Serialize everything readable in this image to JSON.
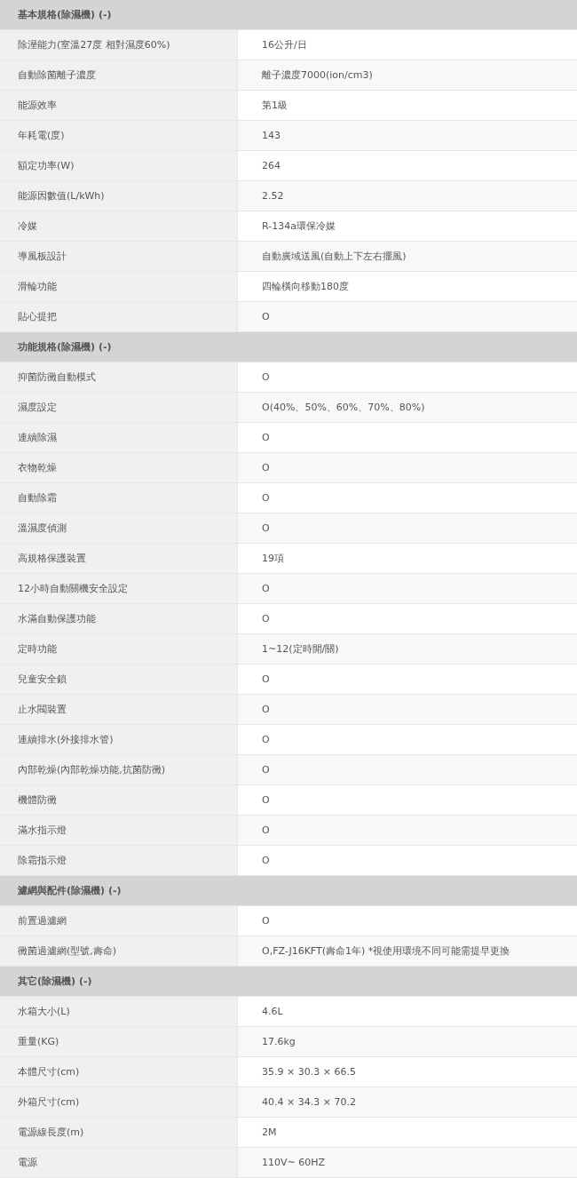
{
  "sections": [
    {
      "title": "基本規格(除濕機) (-)",
      "rows": [
        {
          "label": "除溼能力(室溫27度 相對濕度60%)",
          "value": "16公升/日"
        },
        {
          "label": "自動除菌離子濃度",
          "value": "離子濃度7000(ion/cm3)"
        },
        {
          "label": "能源效率",
          "value": "第1級"
        },
        {
          "label": "年耗電(度)",
          "value": "143"
        },
        {
          "label": "額定功率(W)",
          "value": "264"
        },
        {
          "label": "能源因數值(L/kWh)",
          "value": "2.52"
        },
        {
          "label": "冷媒",
          "value": "R-134a環保冷媒"
        },
        {
          "label": "導風板設計",
          "value": "自動廣域送風(自動上下左右擺風)"
        },
        {
          "label": "滑輪功能",
          "value": "四輪橫向移動180度"
        },
        {
          "label": "貼心提把",
          "value": "O"
        }
      ]
    },
    {
      "title": "功能規格(除濕機) (-)",
      "rows": [
        {
          "label": "抑菌防黴自動模式",
          "value": "O"
        },
        {
          "label": "濕度設定",
          "value": "O(40%、50%、60%、70%、80%)"
        },
        {
          "label": "連續除濕",
          "value": "O"
        },
        {
          "label": "衣物乾燥",
          "value": "O"
        },
        {
          "label": "自動除霜",
          "value": "O"
        },
        {
          "label": "溫濕度偵測",
          "value": "O"
        },
        {
          "label": "高規格保護裝置",
          "value": "19項"
        },
        {
          "label": "12小時自動關機安全設定",
          "value": "O"
        },
        {
          "label": "水滿自動保護功能",
          "value": "O"
        },
        {
          "label": "定時功能",
          "value": "1~12(定時開/關)"
        },
        {
          "label": "兒童安全鎖",
          "value": "O"
        },
        {
          "label": "止水閥裝置",
          "value": "O"
        },
        {
          "label": "連續排水(外接排水管)",
          "value": "O"
        },
        {
          "label": "內部乾燥(內部乾燥功能,抗菌防黴)",
          "value": "O"
        },
        {
          "label": "機體防黴",
          "value": "O"
        },
        {
          "label": "滿水指示燈",
          "value": "O"
        },
        {
          "label": "除霜指示燈",
          "value": "O"
        }
      ]
    },
    {
      "title": "濾網與配件(除濕機) (-)",
      "rows": [
        {
          "label": "前置過濾網",
          "value": "O"
        },
        {
          "label": "黴菌過濾網(型號,壽命)",
          "value": "O,FZ-J16KFT(壽命1年) *視使用環境不同可能需提早更換"
        }
      ]
    },
    {
      "title": "其它(除濕機) (-)",
      "rows": [
        {
          "label": "水箱大小(L)",
          "value": "4.6L"
        },
        {
          "label": "重量(KG)",
          "value": "17.6kg"
        },
        {
          "label": "本體尺寸(cm)",
          "value": "35.9 × 30.3 × 66.5"
        },
        {
          "label": "外箱尺寸(cm)",
          "value": "40.4 × 34.3 × 70.2"
        },
        {
          "label": "電源線長度(m)",
          "value": "2M"
        },
        {
          "label": "電源",
          "value": "110V~ 60HZ"
        }
      ]
    }
  ]
}
